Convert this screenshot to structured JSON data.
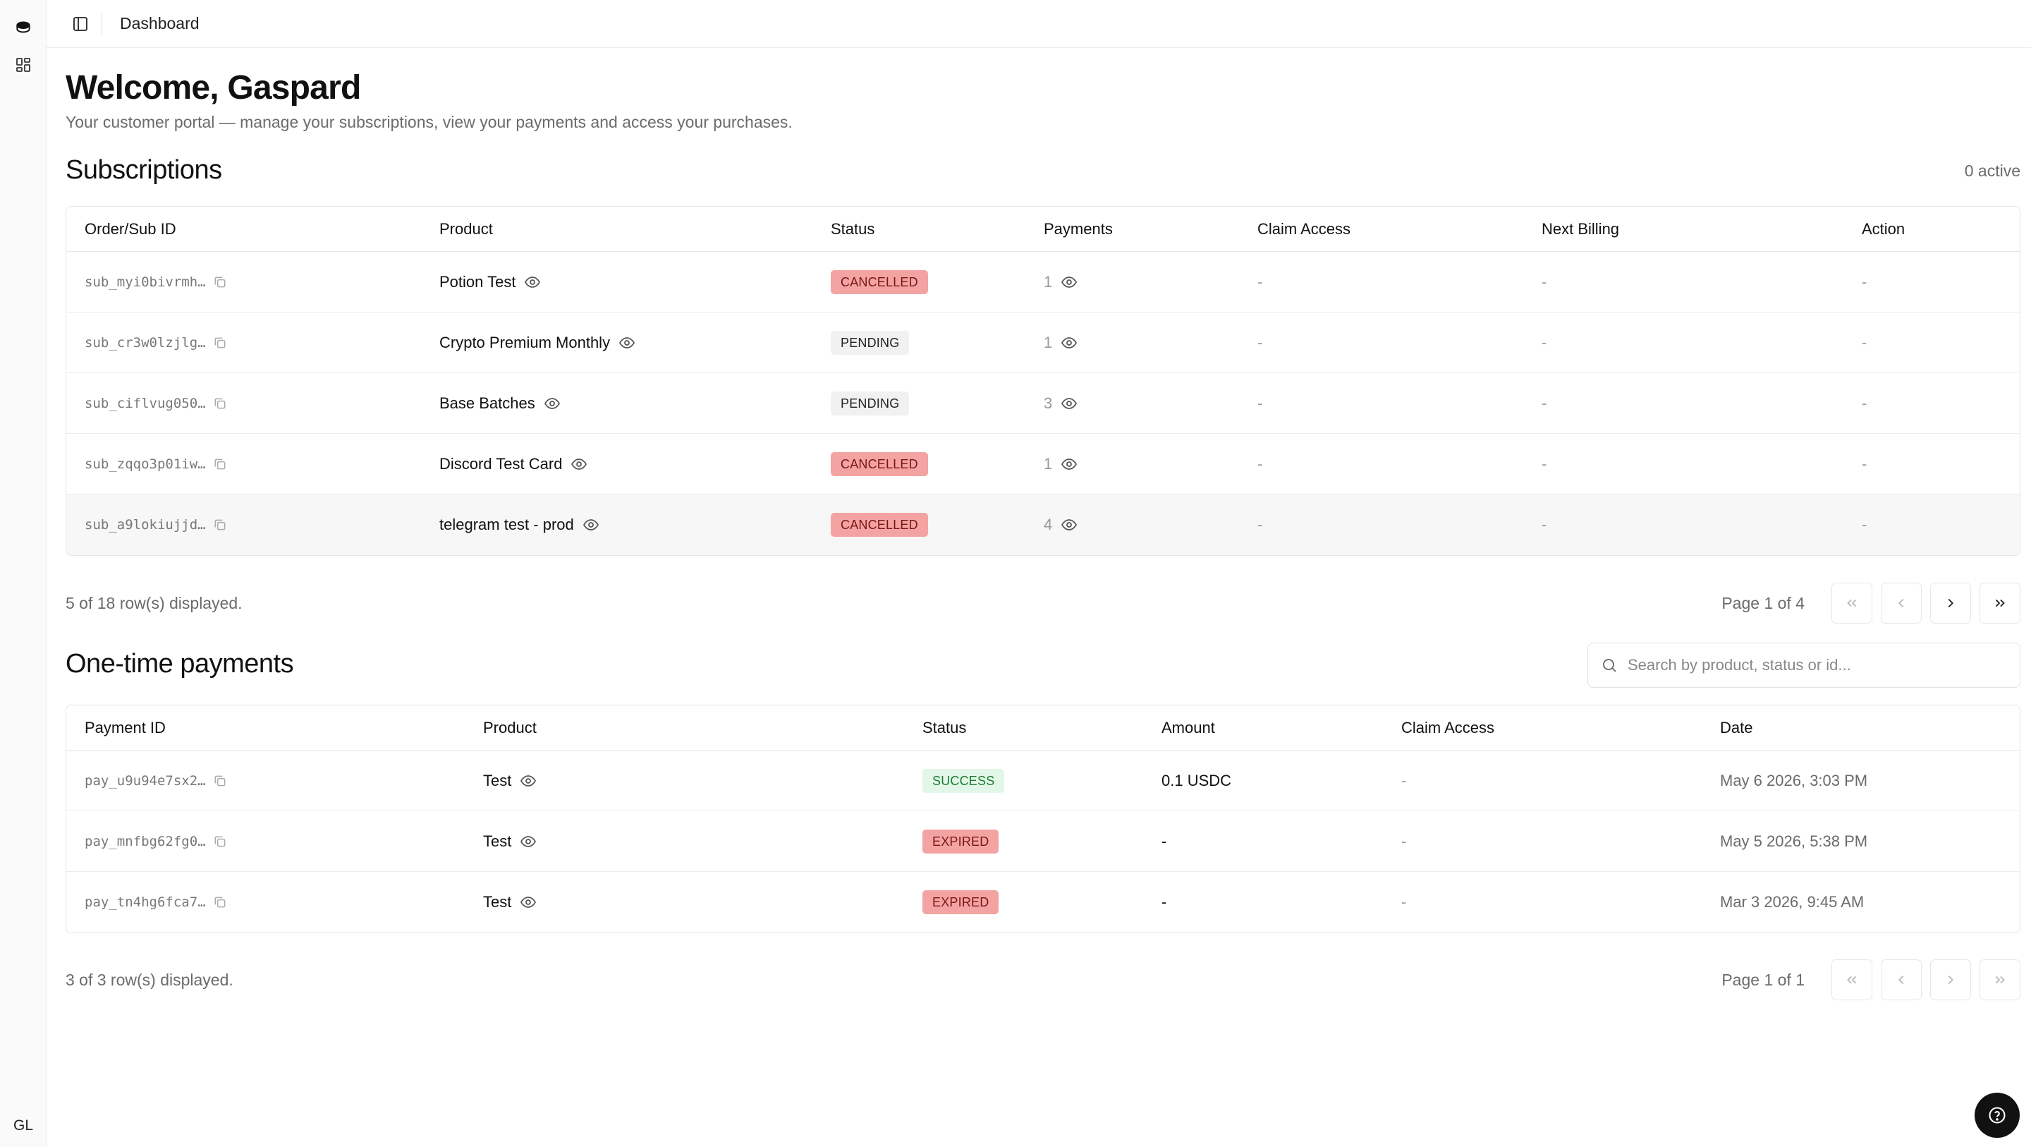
{
  "rail": {
    "user_initials": "GL"
  },
  "topbar": {
    "breadcrumb": "Dashboard"
  },
  "header": {
    "title": "Welcome, Gaspard",
    "subtitle": "Your customer portal — manage your subscriptions, view your payments and access your purchases."
  },
  "subscriptions": {
    "title": "Subscriptions",
    "active_count": "0 active",
    "columns": [
      "Order/Sub ID",
      "Product",
      "Status",
      "Payments",
      "Claim Access",
      "Next Billing",
      "Action"
    ],
    "rows": [
      {
        "id": "sub_myi0bivrmh…",
        "product": "Potion Test",
        "status": "CANCELLED",
        "payments": "1",
        "claim": "-",
        "next_billing": "-",
        "action": "-"
      },
      {
        "id": "sub_cr3w0lzjlg…",
        "product": "Crypto Premium Monthly",
        "status": "PENDING",
        "payments": "1",
        "claim": "-",
        "next_billing": "-",
        "action": "-"
      },
      {
        "id": "sub_ciflvug050…",
        "product": "Base Batches",
        "status": "PENDING",
        "payments": "3",
        "claim": "-",
        "next_billing": "-",
        "action": "-"
      },
      {
        "id": "sub_zqqo3p01iw…",
        "product": "Discord Test Card",
        "status": "CANCELLED",
        "payments": "1",
        "claim": "-",
        "next_billing": "-",
        "action": "-"
      },
      {
        "id": "sub_a9lokiujjd…",
        "product": "telegram test - prod",
        "status": "CANCELLED",
        "payments": "4",
        "claim": "-",
        "next_billing": "-",
        "action": "-"
      }
    ],
    "footer": "5 of 18 row(s) displayed.",
    "page_label": "Page 1 of 4"
  },
  "payments": {
    "title": "One-time payments",
    "search_placeholder": "Search by product, status or id...",
    "columns": [
      "Payment ID",
      "Product",
      "Status",
      "Amount",
      "Claim Access",
      "Date"
    ],
    "rows": [
      {
        "id": "pay_u9u94e7sx2…",
        "product": "Test",
        "status": "SUCCESS",
        "amount": "0.1 USDC",
        "claim": "-",
        "date": "May 6 2026, 3:03 PM"
      },
      {
        "id": "pay_mnfbg62fg0…",
        "product": "Test",
        "status": "EXPIRED",
        "amount": "-",
        "claim": "-",
        "date": "May 5 2026, 5:38 PM"
      },
      {
        "id": "pay_tn4hg6fca7…",
        "product": "Test",
        "status": "EXPIRED",
        "amount": "-",
        "claim": "-",
        "date": "Mar 3 2026, 9:45 AM"
      }
    ],
    "footer": "3 of 3 row(s) displayed.",
    "page_label": "Page 1 of 1"
  },
  "colors": {
    "cancelled_badge": "#f4a3a3",
    "pending_badge": "#f1f1f1",
    "success_badge": "#e2f7e7",
    "help_button": "#111111"
  }
}
